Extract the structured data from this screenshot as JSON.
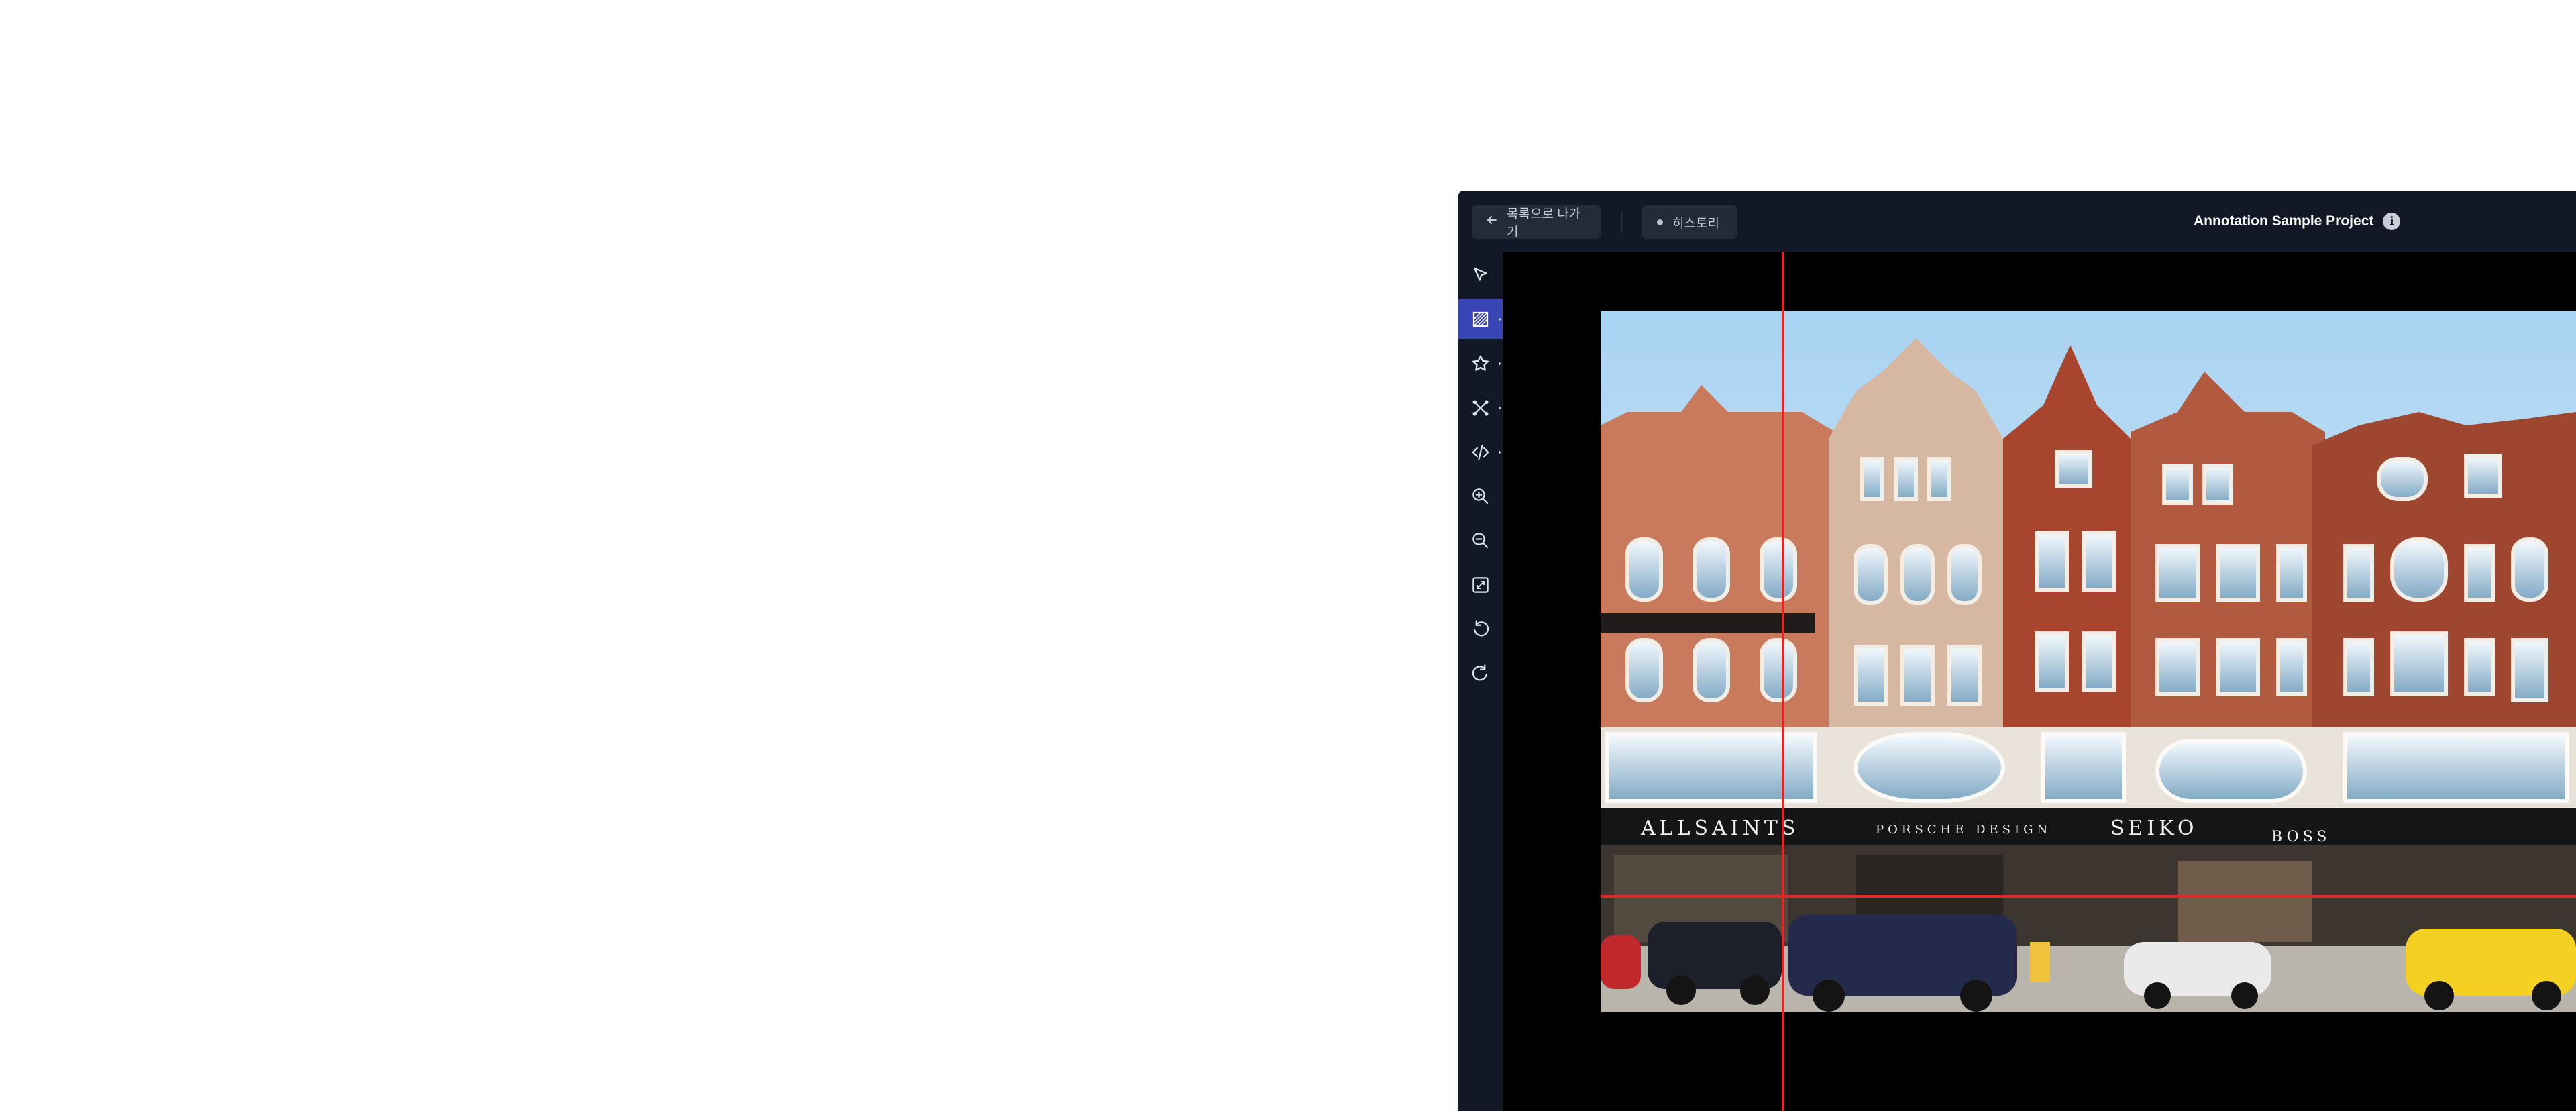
{
  "topbar": {
    "back_label": "목록으로 나가기",
    "history_label": "히스토리",
    "project_title": "Annotation Sample Project"
  },
  "toolbar": {
    "tools": [
      {
        "name": "select-icon"
      },
      {
        "name": "polygon-hatch-icon",
        "active": true
      },
      {
        "name": "star-icon"
      },
      {
        "name": "keypoint-icon"
      },
      {
        "name": "code-icon"
      },
      {
        "name": "zoom-in-icon"
      },
      {
        "name": "zoom-out-icon"
      },
      {
        "name": "fit-screen-icon"
      },
      {
        "name": "undo-icon"
      },
      {
        "name": "redo-icon"
      }
    ]
  },
  "canvas": {
    "image_storefront_signs": [
      "ALLSAINTS",
      "PORSCHE DESIGN",
      "SEIKO",
      "BOSS"
    ],
    "guide_color": "#e32626"
  },
  "colors": {
    "topbar_bg": "#131826",
    "active_tool": "#3a45b5",
    "canvas_bg": "#000000"
  }
}
